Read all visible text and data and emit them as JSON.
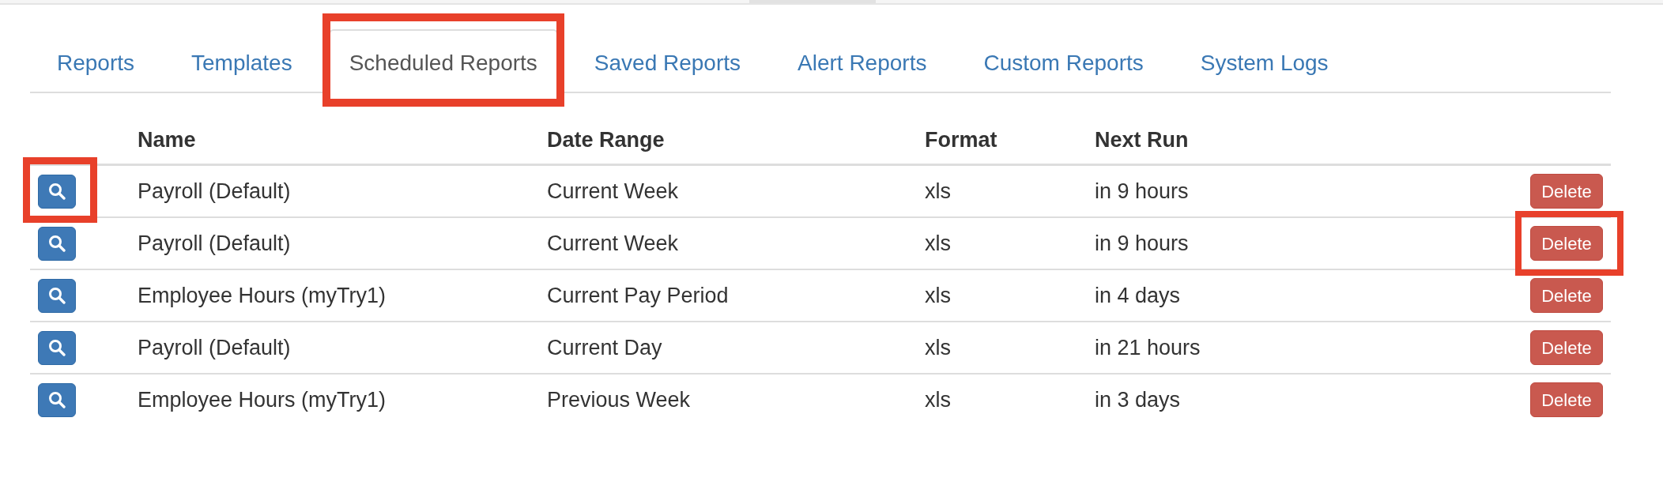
{
  "tabs": [
    {
      "label": "Reports",
      "selected": false,
      "highlighted": false
    },
    {
      "label": "Templates",
      "selected": false,
      "highlighted": false
    },
    {
      "label": "Scheduled Reports",
      "selected": true,
      "highlighted": true
    },
    {
      "label": "Saved Reports",
      "selected": false,
      "highlighted": false
    },
    {
      "label": "Alert Reports",
      "selected": false,
      "highlighted": false
    },
    {
      "label": "Custom Reports",
      "selected": false,
      "highlighted": false
    },
    {
      "label": "System Logs",
      "selected": false,
      "highlighted": false
    }
  ],
  "table": {
    "columns": [
      "Name",
      "Date Range",
      "Format",
      "Next Run"
    ],
    "rows": [
      {
        "name": "Payroll (Default)",
        "date_range": "Current Week",
        "format": "xls",
        "next_run": "in 9 hours",
        "delete_label": "Delete",
        "view_highlighted": true,
        "delete_highlighted": false
      },
      {
        "name": "Payroll (Default)",
        "date_range": "Current Week",
        "format": "xls",
        "next_run": "in 9 hours",
        "delete_label": "Delete",
        "view_highlighted": false,
        "delete_highlighted": true
      },
      {
        "name": "Employee Hours (myTry1)",
        "date_range": "Current Pay Period",
        "format": "xls",
        "next_run": "in 4 days",
        "delete_label": "Delete",
        "view_highlighted": false,
        "delete_highlighted": false
      },
      {
        "name": "Payroll (Default)",
        "date_range": "Current Day",
        "format": "xls",
        "next_run": "in 21 hours",
        "delete_label": "Delete",
        "view_highlighted": false,
        "delete_highlighted": false
      },
      {
        "name": "Employee Hours (myTry1)",
        "date_range": "Previous Week",
        "format": "xls",
        "next_run": "in 3 days",
        "delete_label": "Delete",
        "view_highlighted": false,
        "delete_highlighted": false
      }
    ]
  }
}
